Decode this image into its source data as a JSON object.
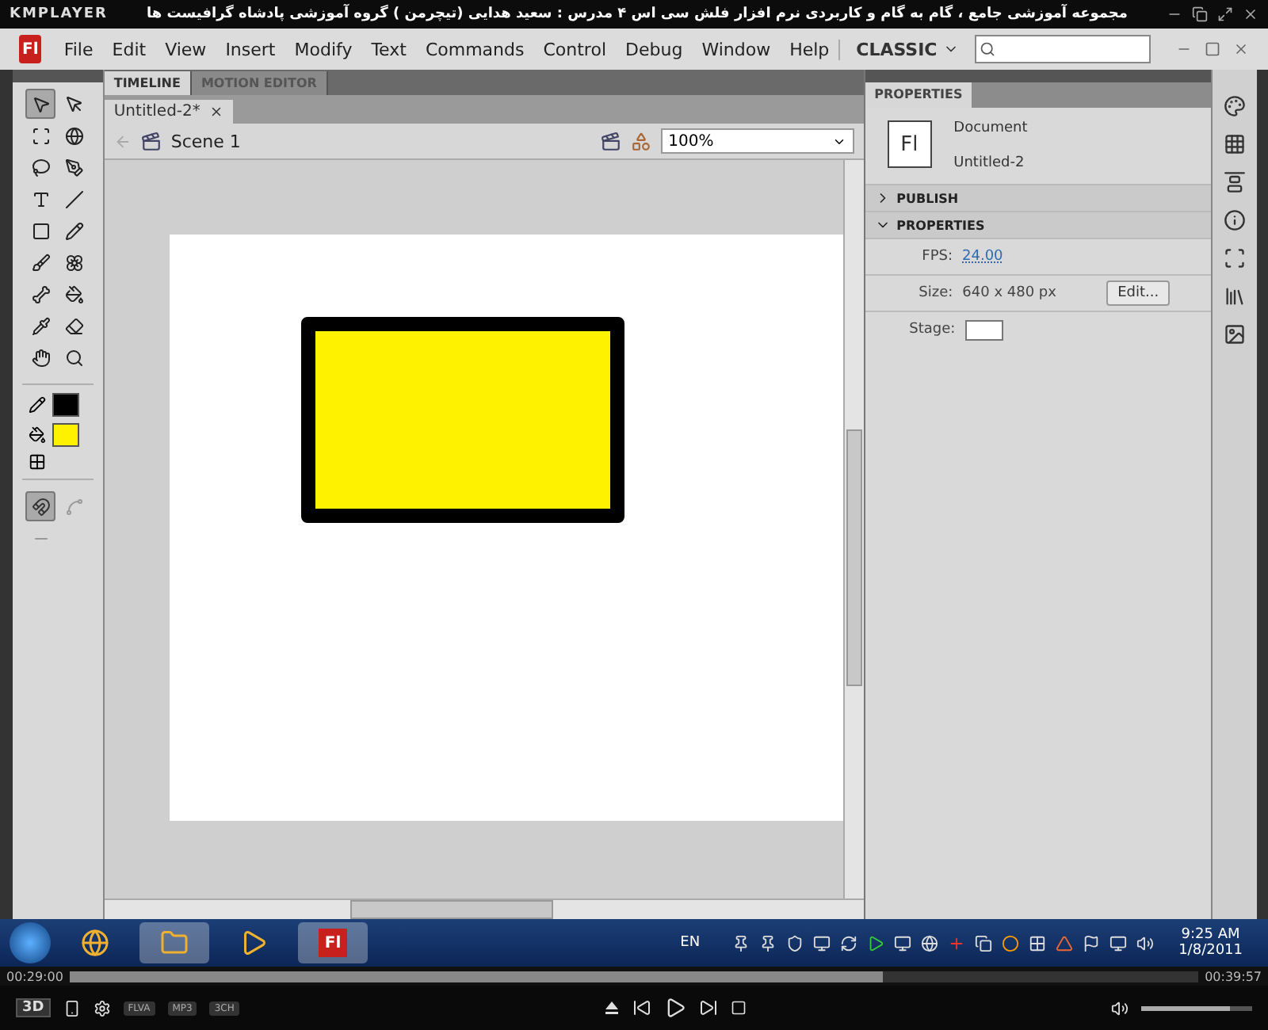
{
  "player": {
    "logo": "KMPLAYER",
    "title": "مجموعه آموزشی جامع ، گام به گام و کاربردی نرم افزار فلش سی اس ۴ مدرس : سعید هدایی (تیچرمن ) گروه آموزشی پادشاه گرافیست ها",
    "elapsed": "00:29:00",
    "total": "00:39:57",
    "level": 0.72,
    "volume": {
      "level": 0.8
    },
    "mode_button": "3D",
    "badges": [
      "FLVA",
      "MP3",
      "3CH"
    ]
  },
  "app": {
    "logo": "Fl",
    "menu": [
      "File",
      "Edit",
      "View",
      "Insert",
      "Modify",
      "Text",
      "Commands",
      "Control",
      "Debug",
      "Window",
      "Help"
    ],
    "workspace": "CLASSIC"
  },
  "panel_tabs": [
    {
      "label": "TIMELINE",
      "selected": true
    },
    {
      "label": "MOTION EDITOR",
      "selected": false
    }
  ],
  "document_tabs": [
    {
      "label": "Untitled-2*",
      "selected": true
    }
  ],
  "scene": {
    "label": "Scene 1",
    "zoom": "100%"
  },
  "tools": [
    {
      "kind": "selection",
      "selected": true
    },
    {
      "kind": "subselection",
      "selected": false
    },
    {
      "kind": "free-transform",
      "selected": false
    },
    {
      "kind": "rotation",
      "selected": false
    },
    {
      "kind": "lasso",
      "selected": false
    },
    {
      "kind": "pen",
      "selected": false
    },
    {
      "kind": "text",
      "selected": false
    },
    {
      "kind": "line",
      "selected": false
    },
    {
      "kind": "rectangle",
      "selected": false
    },
    {
      "kind": "pencil",
      "selected": false
    },
    {
      "kind": "brush",
      "selected": false
    },
    {
      "kind": "deco",
      "selected": false
    },
    {
      "kind": "bone",
      "selected": false
    },
    {
      "kind": "bucket",
      "selected": false
    },
    {
      "kind": "eyedropper",
      "selected": false
    },
    {
      "kind": "eraser",
      "selected": false
    },
    {
      "kind": "hand",
      "selected": false
    },
    {
      "kind": "zoom",
      "selected": false
    }
  ],
  "swatches": [
    {
      "kind": "stroke",
      "color": "#000000"
    },
    {
      "kind": "fill",
      "color": "#fff200"
    }
  ],
  "options": [
    {
      "kind": "snap",
      "on": true
    },
    {
      "kind": "smooth",
      "on": false
    },
    {
      "kind": "straighten",
      "on": false
    }
  ],
  "properties": {
    "title": "PROPERTIES",
    "icon_text": "Fl",
    "type": "Document",
    "name": "Untitled-2",
    "sections": [
      {
        "label": "PUBLISH",
        "expanded": false
      },
      {
        "label": "PROPERTIES",
        "expanded": true
      }
    ],
    "fps_label": "FPS:",
    "fps": "24.00",
    "size_label": "Size:",
    "size": "640 x 480 px",
    "edit_button": "Edit...",
    "stage_label": "Stage:"
  },
  "taskbar": {
    "apps": [
      {
        "kind": "browser",
        "selected": false
      },
      {
        "kind": "folder",
        "selected": true
      },
      {
        "kind": "media",
        "selected": false
      },
      {
        "kind": "flash",
        "label": "Fl",
        "selected": true
      }
    ],
    "language": "EN",
    "time": "9:25 AM",
    "date": "1/8/2011"
  }
}
